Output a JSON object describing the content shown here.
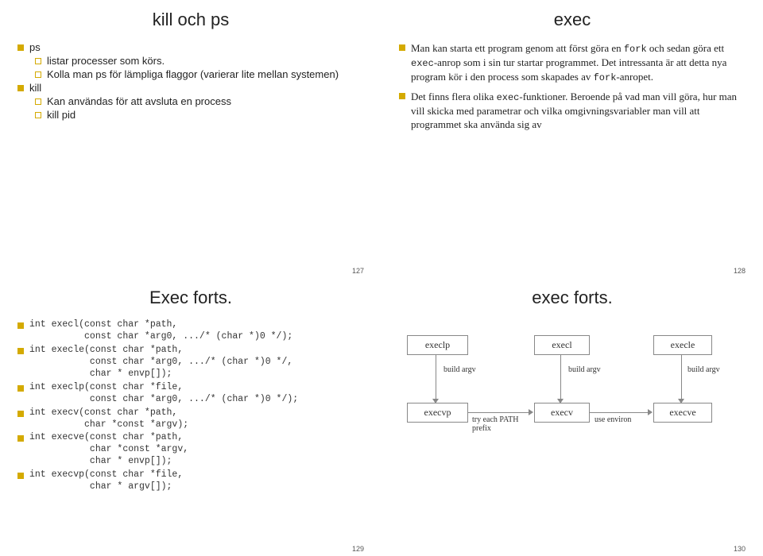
{
  "slide1": {
    "title": "kill och ps",
    "b1": "ps",
    "b1a": "listar processer som körs.",
    "b1b": "Kolla man ps för lämpliga flaggor (varierar lite mellan systemen)",
    "b2": "kill",
    "b2a": "Kan användas för att avsluta en process",
    "b2b": "kill pid",
    "page": "127"
  },
  "slide2": {
    "title": "exec",
    "p1a": "Man kan starta ett program genom att först göra en ",
    "p1b": "fork",
    "p1c": " och sedan göra ett ",
    "p1d": "exec",
    "p1e": "-anrop som i sin tur startar programmet. Det intressanta är att detta nya program kör i den process som skapades av ",
    "p1f": "fork",
    "p1g": "-anropet.",
    "p2a": "Det finns flera olika ",
    "p2b": "exec",
    "p2c": "-funktioner. Beroende på vad man vill göra, hur man vill skicka med parametrar och vilka omgivningsvariabler man vill att programmet ska använda sig av",
    "page": "128"
  },
  "slide3": {
    "title": "Exec forts.",
    "sig1": "int execl(const char *path,\n          const char *arg0, .../* (char *)0 */);",
    "sig2": "int execle(const char *path,\n           const char *arg0, .../* (char *)0 */,\n           char * envp[]);",
    "sig3": "int execlp(const char *file,\n           const char *arg0, .../* (char *)0 */);",
    "sig4": "int execv(const char *path,\n          char *const *argv);",
    "sig5": "int execve(const char *path,\n           char *const *argv,\n           char * envp[]);",
    "sig6": "int execvp(const char *file,\n           char * argv[]);",
    "page": "129"
  },
  "slide4": {
    "title": "exec forts.",
    "box": {
      "execlp": "execlp",
      "execl": "execl",
      "execle": "execle",
      "execvp": "execvp",
      "execv": "execv",
      "execve": "execve"
    },
    "labels": {
      "build1": "build argv",
      "build2": "build argv",
      "build3": "build argv",
      "trypath": "try each PATH\nprefix",
      "useenv": "use environ"
    },
    "page": "130"
  }
}
